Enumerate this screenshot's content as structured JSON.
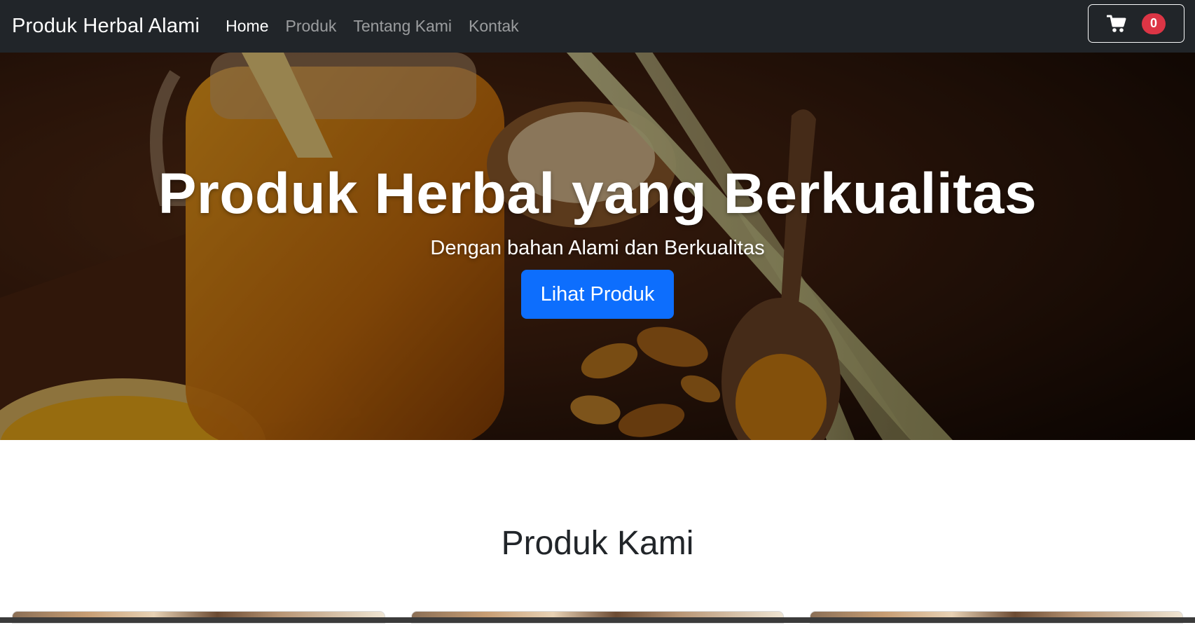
{
  "navbar": {
    "brand": "Produk Herbal Alami",
    "links": [
      {
        "label": "Home",
        "active": true
      },
      {
        "label": "Produk",
        "active": false
      },
      {
        "label": "Tentang Kami",
        "active": false
      },
      {
        "label": "Kontak",
        "active": false
      }
    ],
    "cart": {
      "icon": "cart-icon",
      "count": "0"
    }
  },
  "hero": {
    "title": "Produk Herbal yang Berkualitas",
    "subtitle": "Dengan bahan Alami dan Berkualitas",
    "cta_label": "Lihat Produk"
  },
  "products": {
    "title": "Produk Kami"
  },
  "colors": {
    "navbar_bg": "#212529",
    "primary": "#0d6efd",
    "badge_red": "#dc3545"
  }
}
